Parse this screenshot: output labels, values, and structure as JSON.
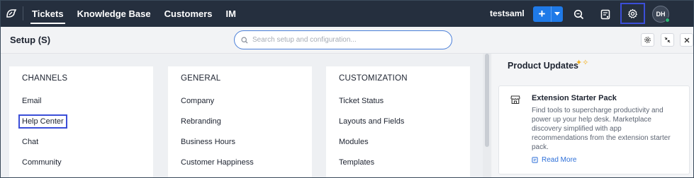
{
  "topbar": {
    "nav": [
      {
        "label": "Tickets",
        "active": true
      },
      {
        "label": "Knowledge Base",
        "active": false
      },
      {
        "label": "Customers",
        "active": false
      },
      {
        "label": "IM",
        "active": false
      }
    ],
    "org_name": "testsaml",
    "add_label": "+",
    "avatar_initials": "DH",
    "icons": [
      "zendesk-logo-icon",
      "plus-icon",
      "chevron-down-icon",
      "search-icon",
      "notes-icon",
      "gear-icon"
    ],
    "accent": "#1f7ae8",
    "highlight": "#3b4ed8"
  },
  "setup": {
    "title": "Setup (S)",
    "search_placeholder": "Search setup and configuration..."
  },
  "columns": [
    {
      "heading": "CHANNELS",
      "items": [
        "Email",
        "Help Center",
        "Chat",
        "Community"
      ]
    },
    {
      "heading": "GENERAL",
      "items": [
        "Company",
        "Rebranding",
        "Business Hours",
        "Customer Happiness"
      ]
    },
    {
      "heading": "CUSTOMIZATION",
      "items": [
        "Ticket Status",
        "Layouts and Fields",
        "Modules",
        "Templates"
      ]
    }
  ],
  "updates": {
    "title": "Product Updates",
    "card": {
      "title": "Extension Starter Pack",
      "description": "Find tools to supercharge productivity and power up your help desk. Marketplace discovery simplified with app recommendations from the extension starter pack.",
      "link": "Read More"
    }
  }
}
